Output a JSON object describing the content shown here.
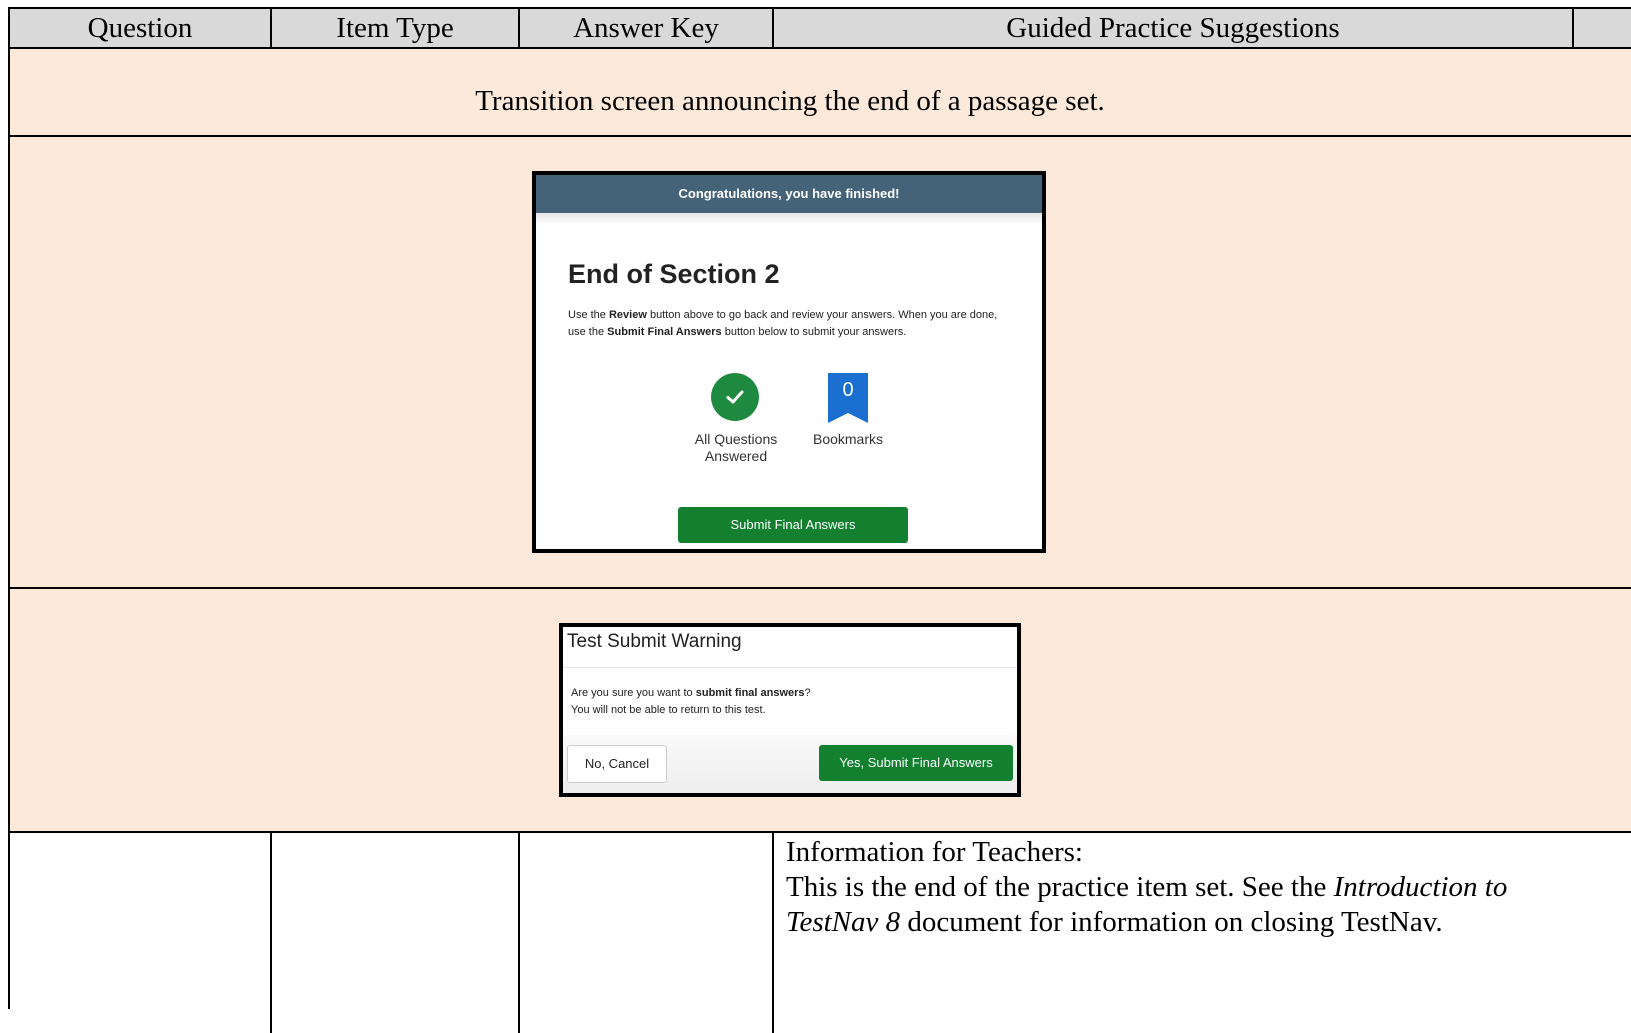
{
  "table": {
    "headers": [
      "Question",
      "Item Type",
      "Answer Key",
      "Guided Practice Suggestions"
    ]
  },
  "transition_text": "Transition screen announcing the end of a passage set.",
  "end_screen": {
    "banner": "Congratulations, you have finished!",
    "title": "End of Section 2",
    "instr_1": "Use the ",
    "instr_review": "Review",
    "instr_2": " button above to go back and review your answers. When you are done, use the ",
    "instr_submit": "Submit Final Answers",
    "instr_3": " button below to submit your answers.",
    "answered_label_1": "All Questions",
    "answered_label_2": "Answered",
    "bookmark_count": "0",
    "bookmarks_label": "Bookmarks",
    "submit_button": "Submit Final Answers"
  },
  "warning_dialog": {
    "title": "Test Submit Warning",
    "msg_1": "Are you sure you want to ",
    "msg_bold": "submit final answers",
    "msg_2": "?",
    "msg_line2": "You will not be able to return to this test.",
    "cancel_button": "No, Cancel",
    "confirm_button": "Yes, Submit Final Answers"
  },
  "info": {
    "heading": "Information for Teachers:",
    "text_1": "This is the end of the practice item set. See the ",
    "text_italic_1": "Introduction to",
    "text_italic_2": "TestNav 8",
    "text_2": " document for information on closing TestNav."
  },
  "colors": {
    "header_bg": "#d9d9d9",
    "row_bg": "#fde9d9",
    "banner": "#446278",
    "green": "#12802f",
    "bookmark_blue": "#1a6fd0"
  },
  "icons": [
    "checkmark-icon",
    "bookmark-icon"
  ]
}
